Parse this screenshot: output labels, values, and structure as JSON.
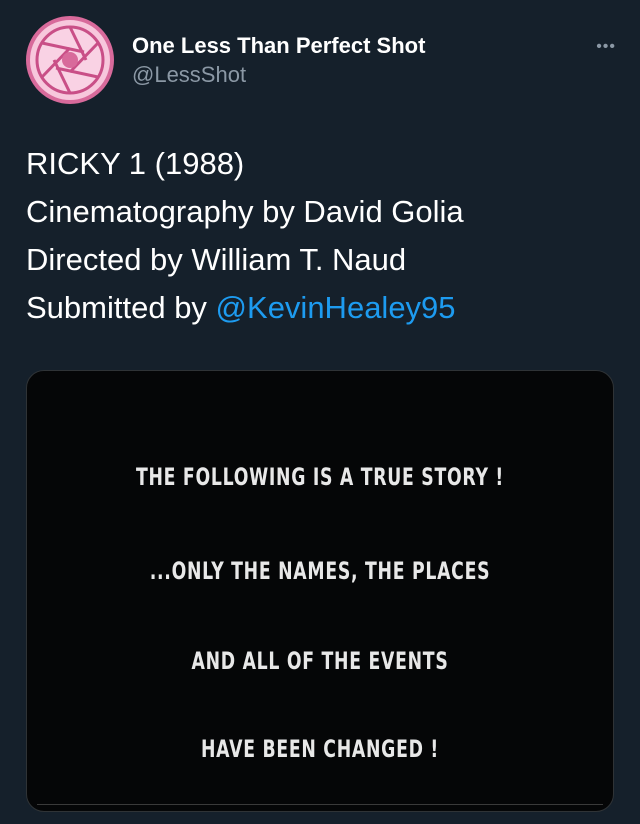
{
  "author": {
    "display_name": "One Less Than Perfect Shot",
    "handle": "@LessShot",
    "avatar_icon": "camera-aperture-icon",
    "more_label": "•••"
  },
  "tweet": {
    "line1": "RICKY 1 (1988)",
    "line2": "Cinematography by David Golia",
    "line3": "Directed by William T. Naud",
    "line4_prefix": "Submitted by ",
    "mention": "@KevinHealey95"
  },
  "media": {
    "captions": [
      "THE FOLLOWING IS A TRUE STORY !",
      "...ONLY THE NAMES, THE PLACES",
      "AND ALL OF THE EVENTS",
      "HAVE BEEN CHANGED !"
    ]
  },
  "colors": {
    "background": "#15202b",
    "link": "#1d9bf0",
    "secondary_text": "#8b98a5",
    "avatar_pink": "#d86a9b"
  }
}
